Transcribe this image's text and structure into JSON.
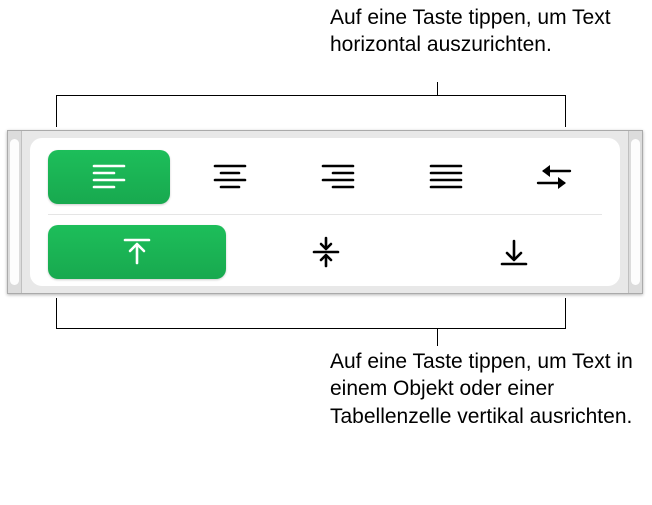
{
  "callouts": {
    "top": "Auf eine Taste tippen, um Text horizontal auszurichten.",
    "bottom": "Auf eine Taste tippen, um Text in einem Objekt oder einer Tabellenzelle vertikal ausrichten."
  },
  "colors": {
    "accent": "#1DB954",
    "icon_dark": "#000000",
    "icon_light": "#ffffff"
  },
  "horizontal": {
    "buttons": [
      {
        "name": "align-left",
        "selected": true
      },
      {
        "name": "align-center",
        "selected": false
      },
      {
        "name": "align-right",
        "selected": false
      },
      {
        "name": "align-justify",
        "selected": false
      },
      {
        "name": "text-direction",
        "selected": false
      }
    ]
  },
  "vertical": {
    "buttons": [
      {
        "name": "align-top",
        "selected": true
      },
      {
        "name": "align-middle",
        "selected": false
      },
      {
        "name": "align-bottom",
        "selected": false
      }
    ]
  }
}
